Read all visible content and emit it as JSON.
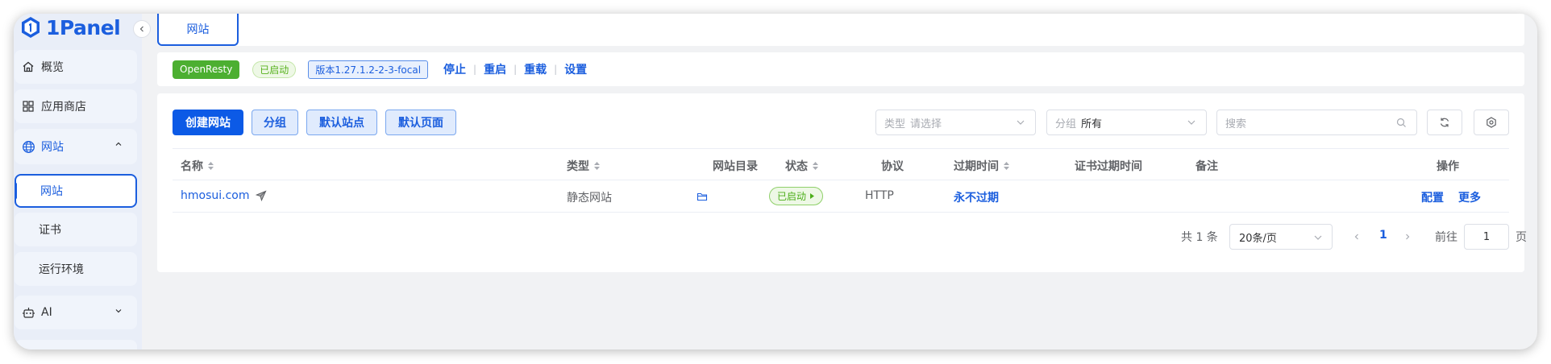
{
  "app": {
    "name": "1Panel"
  },
  "sidebar": {
    "items": [
      {
        "label": "概览",
        "icon": "home-icon"
      },
      {
        "label": "应用商店",
        "icon": "grid-icon"
      },
      {
        "label": "网站",
        "icon": "globe-icon",
        "expanded": true
      },
      {
        "label": "AI",
        "icon": "robot-icon"
      }
    ],
    "submenu": [
      {
        "label": "网站",
        "selected": true
      },
      {
        "label": "证书"
      },
      {
        "label": "运行环境"
      }
    ]
  },
  "tabs": {
    "active": "网站"
  },
  "status_bar": {
    "server": "OpenResty",
    "state": "已启动",
    "version": "版本1.27.1.2-2-3-focal",
    "actions": [
      "停止",
      "重启",
      "重载",
      "设置"
    ]
  },
  "toolbar": {
    "create": "创建网站",
    "group": "分组",
    "default_site": "默认站点",
    "default_page": "默认页面",
    "type_filter": {
      "prefix": "类型",
      "placeholder": "请选择"
    },
    "group_filter": {
      "prefix": "分组",
      "value": "所有"
    },
    "search_placeholder": "搜索"
  },
  "table": {
    "columns": [
      "名称",
      "类型",
      "网站目录",
      "状态",
      "协议",
      "过期时间",
      "证书过期时间",
      "备注",
      "操作"
    ],
    "rows": [
      {
        "name": "hmosui.com",
        "type": "静态网站",
        "status": "已启动",
        "protocol": "HTTP",
        "expire": "永不过期",
        "cert_expire": "",
        "remark": "",
        "actions": [
          "配置",
          "更多"
        ]
      }
    ]
  },
  "pagination": {
    "total_text": "共 1 条",
    "page_size": "20条/页",
    "current_page": "1",
    "goto_prefix": "前往",
    "goto_value": "1",
    "goto_suffix": "页"
  },
  "colors": {
    "accent": "#1b5ede",
    "success": "#4caf31",
    "background": "#f1f2f4"
  }
}
